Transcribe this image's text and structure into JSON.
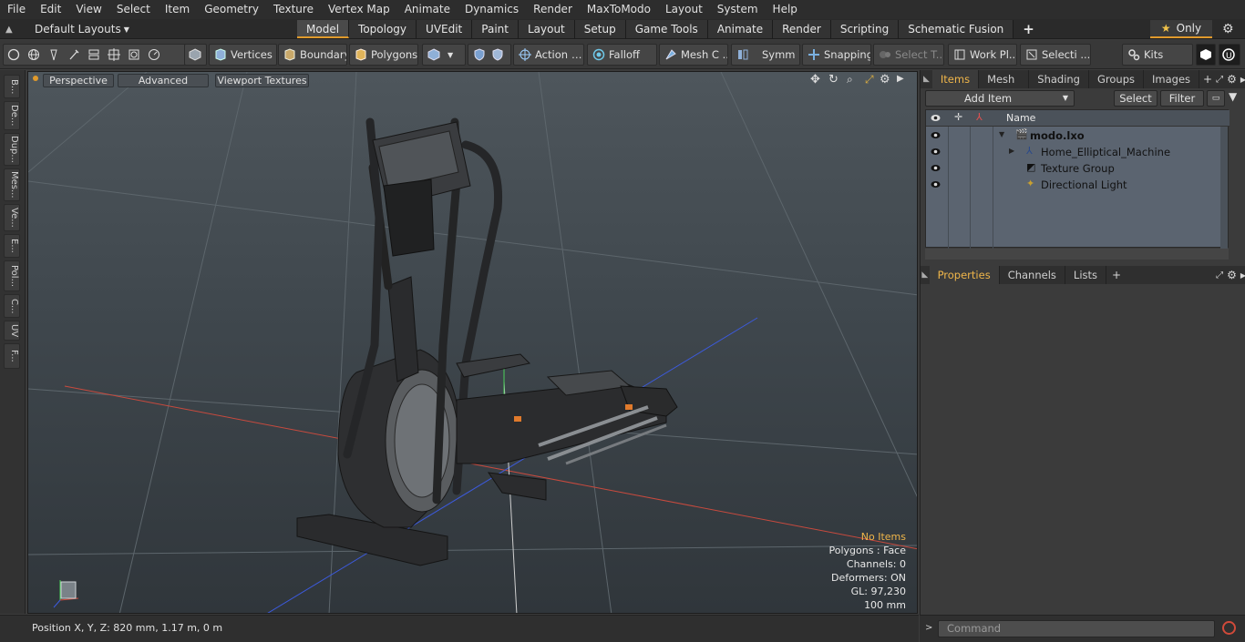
{
  "menubar": {
    "items": [
      "File",
      "Edit",
      "View",
      "Select",
      "Item",
      "Geometry",
      "Texture",
      "Vertex Map",
      "Animate",
      "Dynamics",
      "Render",
      "MaxToModo",
      "Layout",
      "System",
      "Help"
    ]
  },
  "layout": {
    "label": "Default Layouts"
  },
  "tabs": [
    "Model",
    "Topology",
    "UVEdit",
    "Paint",
    "Layout",
    "Setup",
    "Game Tools",
    "Animate",
    "Render",
    "Scripting",
    "Schematic Fusion"
  ],
  "active_tab": "Model",
  "only_label": "Only",
  "toolbar": {
    "vertices": "Vertices",
    "boundary": "Boundary",
    "polygons": "Polygons",
    "action": "Action",
    "falloff": "Falloff",
    "mesh": "Mesh C ...",
    "symm": "Symm ...",
    "snapping": "Snapping",
    "select_t": "Select T...",
    "workplane": "Work Pl...",
    "selecti": "Selecti ...",
    "kits": "Kits"
  },
  "leftstrip": [
    "B...",
    "De...",
    "Dup...",
    "Mes...",
    "Ve...",
    "E...",
    "Pol...",
    "C...",
    "UV",
    "F..."
  ],
  "viewport": {
    "perspective": "Perspective",
    "advanced": "Advanced",
    "textures": "Viewport Textures",
    "info": {
      "no_items": "No Items",
      "polygons": "Polygons : Face",
      "channels": "Channels: 0",
      "deformers": "Deformers: ON",
      "gl": "GL: 97,230",
      "scale": "100 mm"
    }
  },
  "status": {
    "position": "Position X, Y, Z:   820 mm, 1.17 m, 0 m"
  },
  "items_panel": {
    "tabs": [
      "Items",
      "Mesh ...",
      "Shading",
      "Groups",
      "Images"
    ],
    "add_item": "Add Item",
    "select": "Select",
    "filter": "Filter",
    "col_name": "Name",
    "rows": [
      "modo.lxo",
      "Home_Elliptical_Machine",
      "Texture Group",
      "Directional Light"
    ]
  },
  "props_panel": {
    "tabs": [
      "Properties",
      "Channels",
      "Lists"
    ]
  },
  "command": {
    "placeholder": "Command"
  },
  "colors": {
    "accent": "#e09a2c",
    "axis_x": "#d24b3c",
    "axis_z": "#3c5adc",
    "axis_y": "#4bd25a"
  }
}
